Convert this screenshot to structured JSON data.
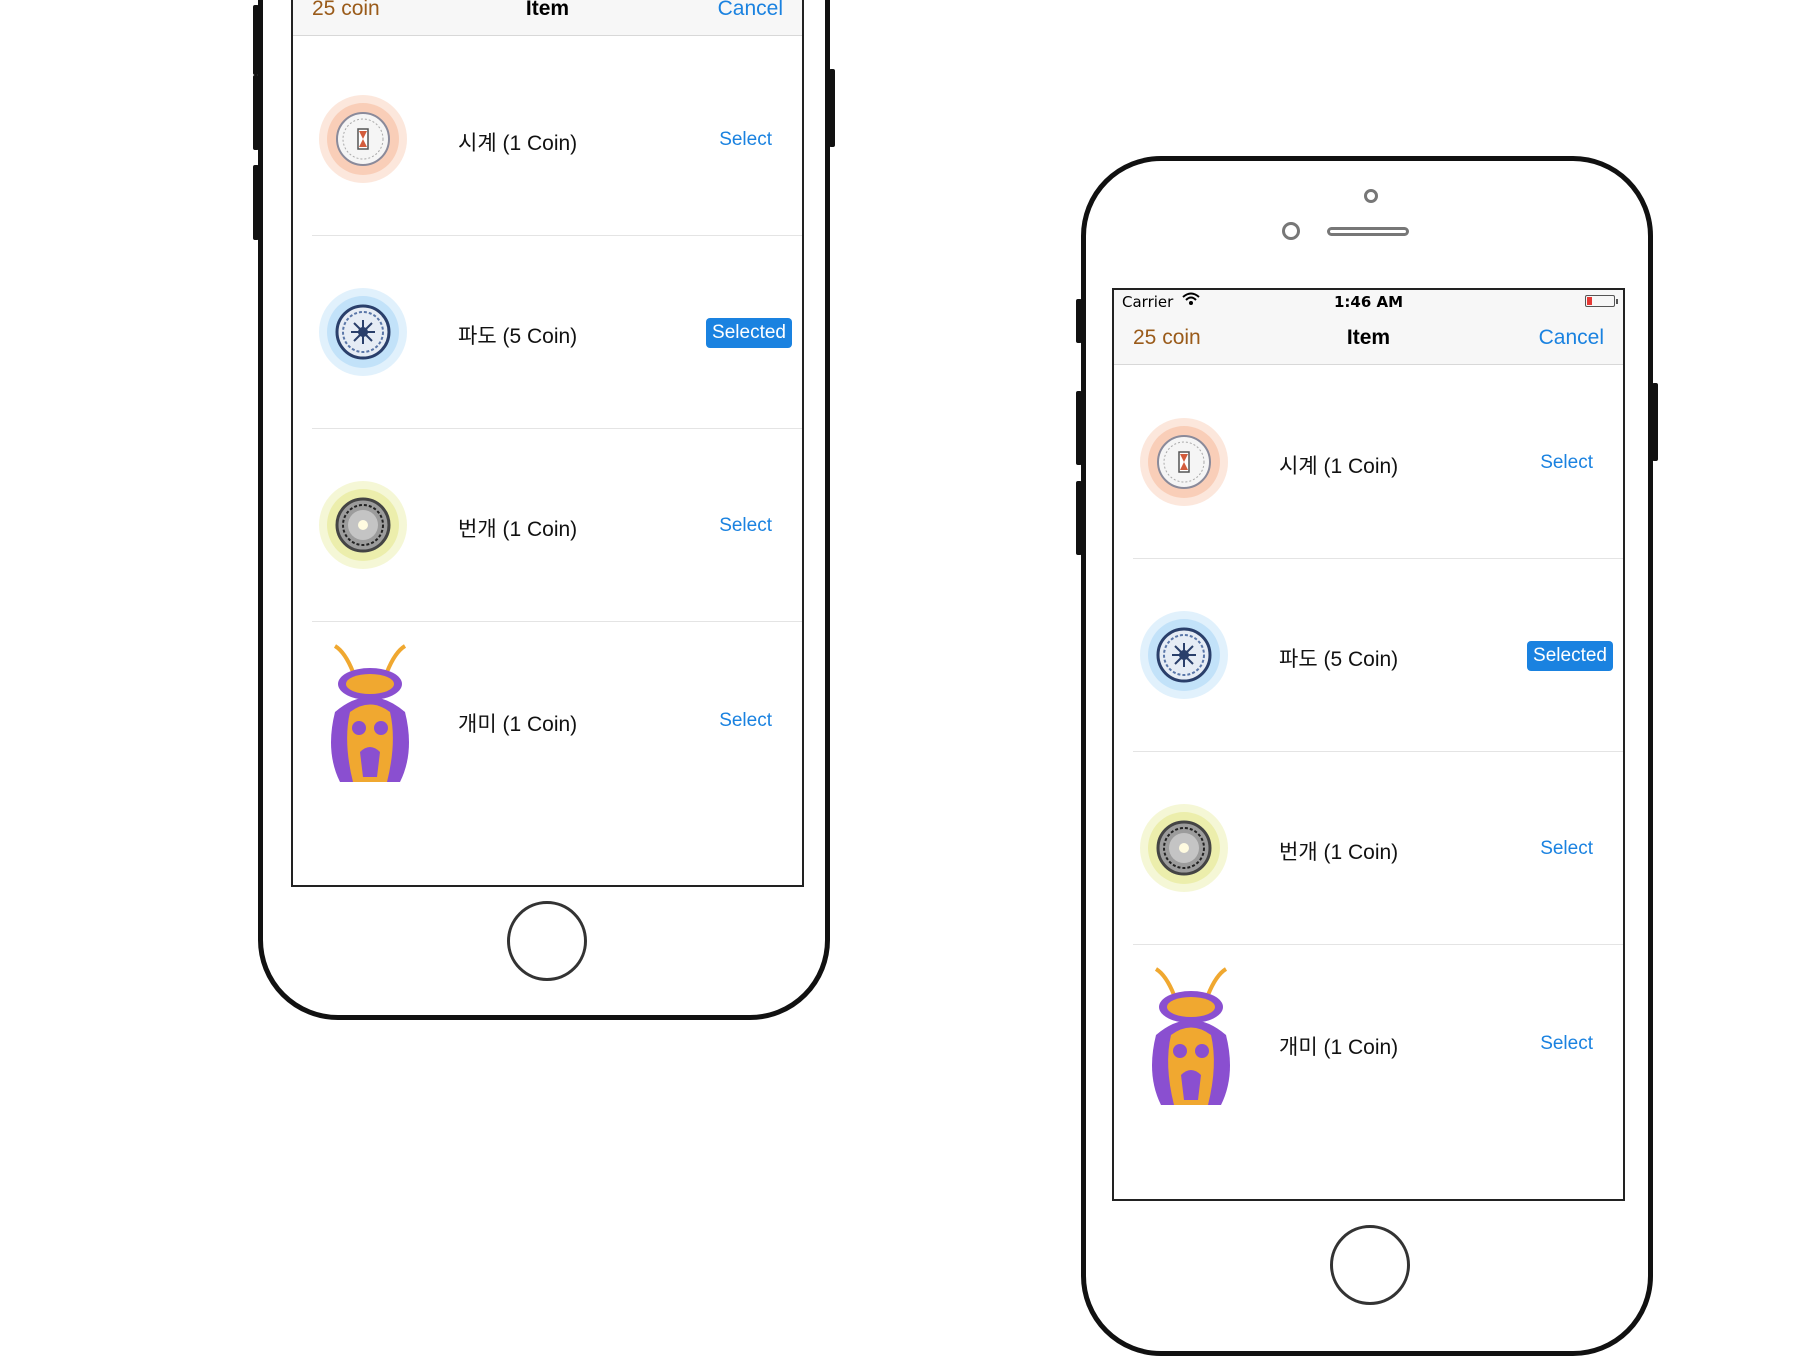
{
  "status_bar": {
    "carrier": "Carrier",
    "time": "1:46 AM"
  },
  "nav": {
    "coin_label": "25 coin",
    "title": "Item",
    "cancel_label": "Cancel"
  },
  "items": [
    {
      "icon": "clock-orb-icon",
      "label": "시계 (1 Coin)",
      "action": "Select",
      "selected": false
    },
    {
      "icon": "wave-orb-icon",
      "label": "파도 (5 Coin)",
      "action": "Selected",
      "selected": true
    },
    {
      "icon": "lightning-orb-icon",
      "label": "번개 (1 Coin)",
      "action": "Select",
      "selected": false
    },
    {
      "icon": "ant-icon",
      "label": "개미 (1 Coin)",
      "action": "Select",
      "selected": false
    }
  ],
  "colors": {
    "accent": "#1a82e0",
    "coin": "#9a5b1a",
    "clock_glow": "#f6b99a",
    "wave_glow": "#a9d6f5",
    "lightning_glow": "#e3e88a",
    "ant_body": "#8a4fd0",
    "ant_accent": "#f0a830"
  }
}
